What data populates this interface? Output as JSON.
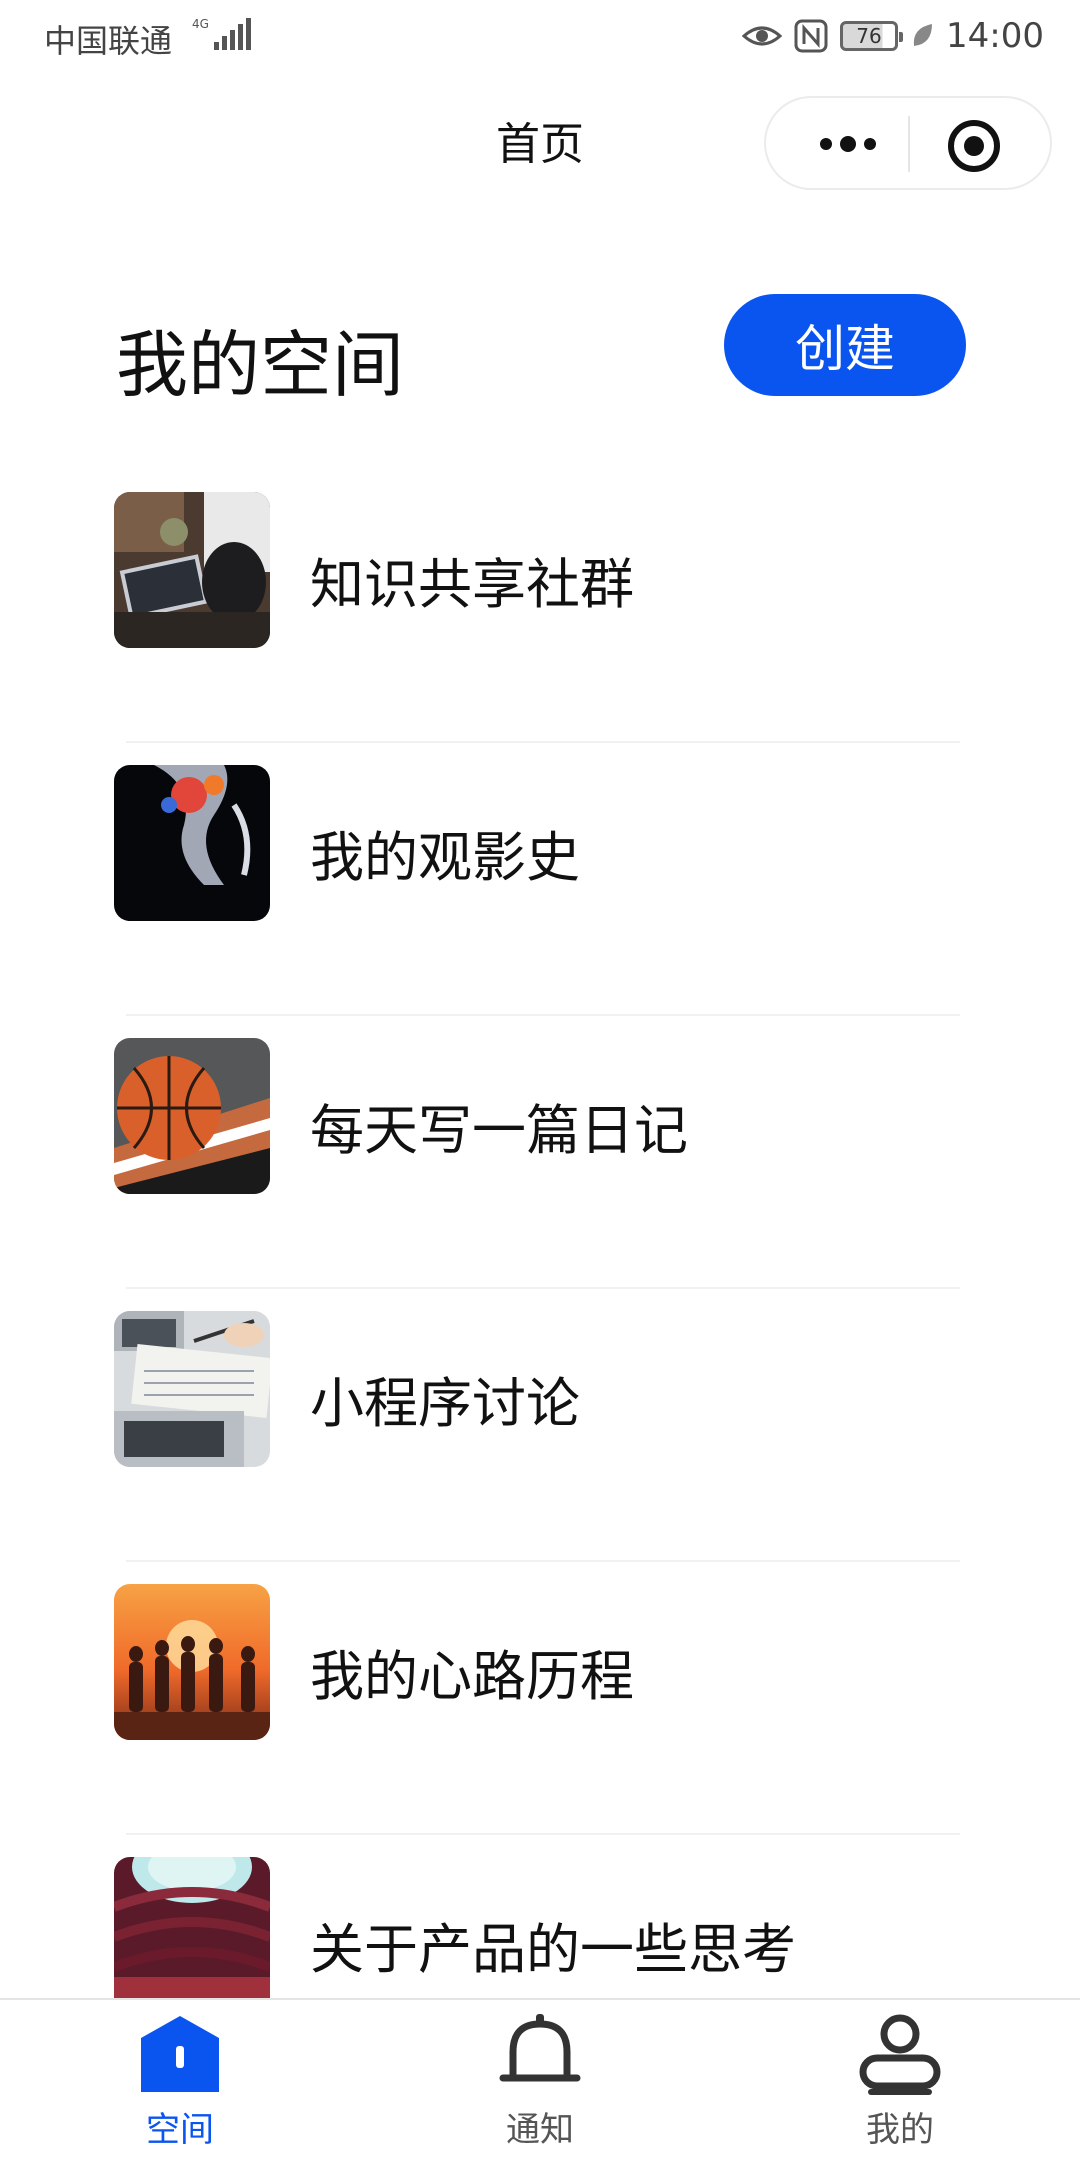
{
  "status_bar": {
    "carrier": "中国联通",
    "network": "4G",
    "battery": "76",
    "time": "14:00"
  },
  "nav": {
    "title": "首页"
  },
  "space": {
    "title": "我的空间",
    "create_label": "创建"
  },
  "items": [
    {
      "label": "知识共享社群",
      "image": "laptop-workspace-photo"
    },
    {
      "label": "我的观影史",
      "image": "abstract-dark-photo"
    },
    {
      "label": "每天写一篇日记",
      "image": "basketball-photo"
    },
    {
      "label": "小程序讨论",
      "image": "notebook-laptop-photo"
    },
    {
      "label": "我的心路历程",
      "image": "sunset-people-photo"
    },
    {
      "label": "关于产品的一些思考",
      "image": "architecture-photo"
    }
  ],
  "tabs": [
    {
      "label": "空间",
      "icon": "home-icon",
      "active": true
    },
    {
      "label": "通知",
      "icon": "bell-icon",
      "active": false
    },
    {
      "label": "我的",
      "icon": "user-icon",
      "active": false
    }
  ],
  "colors": {
    "accent": "#0a54f0",
    "text": "#111111",
    "tab_inactive": "#555555"
  }
}
